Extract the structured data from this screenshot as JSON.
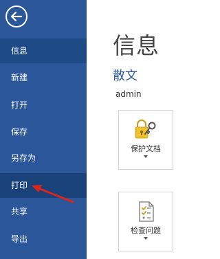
{
  "sidebar": {
    "items": [
      {
        "label": "信息"
      },
      {
        "label": "新建"
      },
      {
        "label": "打开"
      },
      {
        "label": "保存"
      },
      {
        "label": "另存为"
      },
      {
        "label": "打印"
      },
      {
        "label": "共享"
      },
      {
        "label": "导出"
      }
    ]
  },
  "main": {
    "page_title": "信息",
    "doc_title": "散文",
    "author": "admin",
    "cards": [
      {
        "label": "保护文档",
        "icon": "lock-key-icon"
      },
      {
        "label": "检查问题",
        "icon": "inspect-document-icon"
      }
    ]
  },
  "colors": {
    "sidebar_bg": "#2b579a",
    "active_item_bg": "#1e4a86",
    "accent": "#2b579a",
    "annotation_arrow": "#d9261c"
  }
}
